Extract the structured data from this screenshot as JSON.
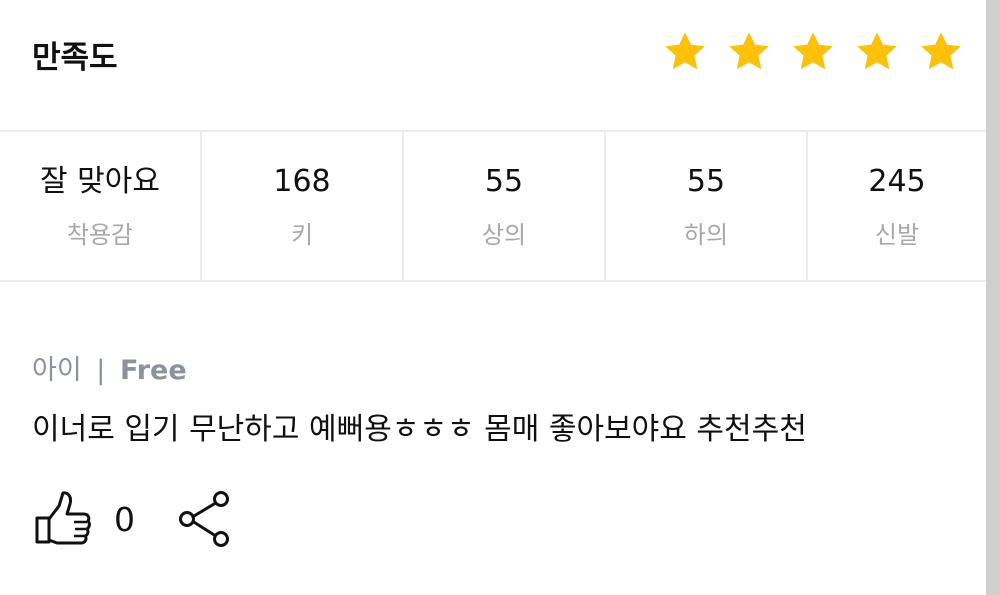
{
  "rating": {
    "title": "만족도",
    "stars": 5,
    "max_stars": 5,
    "star_color": "#FFC107",
    "star_icon": "star-icon"
  },
  "size_info": [
    {
      "value": "잘 맞아요",
      "label": "착용감"
    },
    {
      "value": "168",
      "label": "키"
    },
    {
      "value": "55",
      "label": "상의"
    },
    {
      "value": "55",
      "label": "하의"
    },
    {
      "value": "245",
      "label": "신발"
    }
  ],
  "review": {
    "author": "아이",
    "separator": "|",
    "tag": "Free",
    "body": "이너로 입기 무난하고 예뻐용ㅎㅎㅎ 몸매 좋아보야요 추천추천"
  },
  "actions": {
    "like_count": "0",
    "like_icon": "thumbs-up-icon",
    "share_icon": "share-icon"
  }
}
